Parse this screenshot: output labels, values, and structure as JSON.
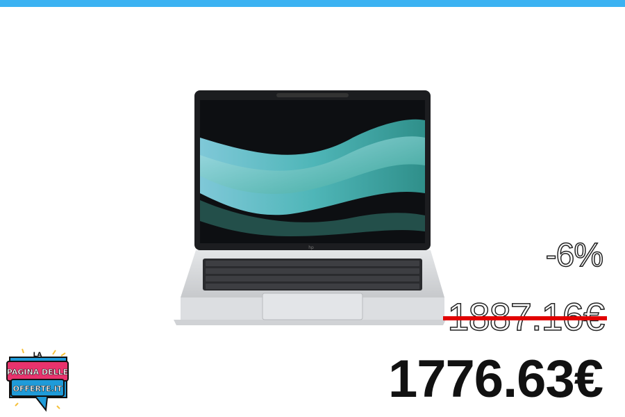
{
  "product": {
    "image_alt": "HP laptop",
    "discount": "-6%",
    "old_price": "1887.16€",
    "new_price": "1776.63€"
  },
  "logo": {
    "line1": "LA",
    "line2": "PAGINA DELLE",
    "line3": "OFFERTE.IT"
  },
  "colors": {
    "topbar": "#3bb2f2",
    "strike": "#e10000",
    "logo_pink": "#e8336d",
    "logo_blue": "#1f9bd9",
    "logo_yellow": "#f6c13a"
  }
}
